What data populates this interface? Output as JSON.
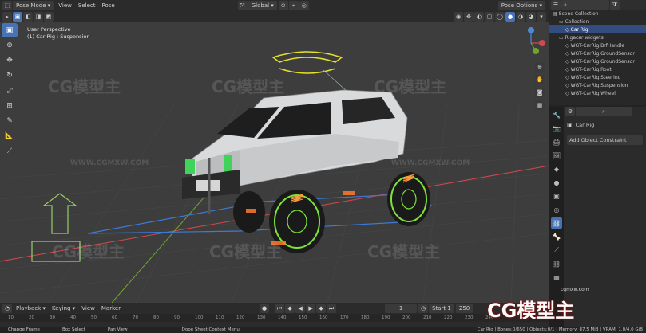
{
  "header": {
    "mode": "Pose Mode",
    "menus": [
      "View",
      "Select",
      "Pose"
    ],
    "transform_orientation": "Global",
    "pose_options": "Pose Options"
  },
  "viewport": {
    "perspective": "User Perspective",
    "object_info": "(1) Car Rig : Suspension",
    "watermark_text": "CG模型主",
    "watermark_url": "WWW.CGMXW.COM"
  },
  "outliner": {
    "rows": [
      {
        "label": "Scene Collection",
        "depth": 0,
        "selected": false
      },
      {
        "label": "Collection",
        "depth": 1,
        "selected": false
      },
      {
        "label": "Car Rig",
        "depth": 2,
        "selected": true
      },
      {
        "label": "Rigacar widgets",
        "depth": 1,
        "selected": false
      },
      {
        "label": "WGT-CarRig.BrfHandle",
        "depth": 2,
        "selected": false
      },
      {
        "label": "WGT-CarRig.GroundSensor",
        "depth": 2,
        "selected": false
      },
      {
        "label": "WGT-CarRig.GroundSensor",
        "depth": 2,
        "selected": false
      },
      {
        "label": "WGT-CarRig.Root",
        "depth": 2,
        "selected": false
      },
      {
        "label": "WGT-CarRig.Steering",
        "depth": 2,
        "selected": false
      },
      {
        "label": "WGT-CarRig.Suspension",
        "depth": 2,
        "selected": false
      },
      {
        "label": "WGT-CarRig.Wheel",
        "depth": 2,
        "selected": false
      }
    ]
  },
  "properties": {
    "object_name": "Car Rig",
    "add_constraint": "Add Object Constraint"
  },
  "timeline": {
    "menus": [
      "Playback",
      "Keying",
      "View",
      "Marker"
    ],
    "current_frame": "1",
    "start_label": "Start",
    "start_value": "1",
    "end_value": "250",
    "ruler": [
      "10",
      "20",
      "30",
      "40",
      "50",
      "60",
      "70",
      "80",
      "90",
      "100",
      "110",
      "120",
      "130",
      "140",
      "150",
      "160",
      "170",
      "180",
      "190",
      "200",
      "210",
      "220",
      "230",
      "240"
    ]
  },
  "status_bar": {
    "left": "Change Frame",
    "box_select": "Box Select",
    "pan": "Pan View",
    "context": "Dope Sheet Context Menu",
    "right": "Car Rig | Bones:0/650 | Objects:0/1 | Memory: 87.5 MiB | VRAM: 1.0/4.0 GiB"
  },
  "branding": {
    "corner_site": "cgmxw.com",
    "corner_logo": "CG模型主"
  },
  "colors": {
    "selection": "#4772b3",
    "rig_green": "#7fe33a",
    "rig_yellow": "#e6e02a",
    "rig_orange": "#ff7a2a",
    "axis_red": "#d6484d",
    "axis_green": "#6fa52f"
  }
}
